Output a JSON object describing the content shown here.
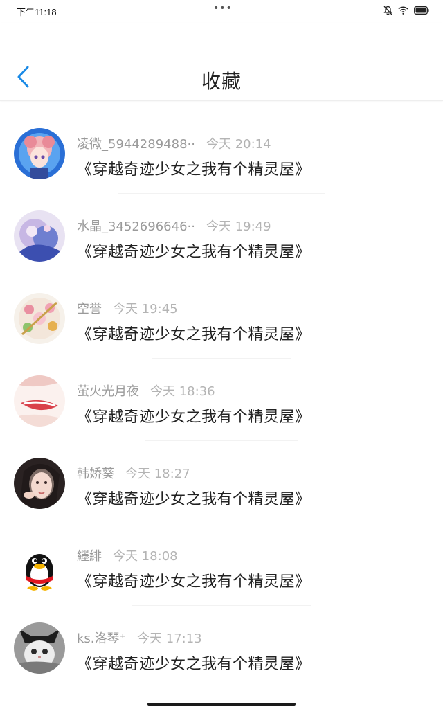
{
  "status": {
    "time": "下午11:18",
    "dots": "•••"
  },
  "header": {
    "title": "收藏"
  },
  "items": [
    {
      "name": "凌微_5944289488··",
      "time": "今天 20:14",
      "title": "《穿越奇迹少女之我有个精灵屋》"
    },
    {
      "name": "水晶_3452696646··",
      "time": "今天 19:49",
      "title": "《穿越奇迹少女之我有个精灵屋》"
    },
    {
      "name": "空誉",
      "time": "今天 19:45",
      "title": "《穿越奇迹少女之我有个精灵屋》"
    },
    {
      "name": "萤火光月夜",
      "time": "今天 18:36",
      "title": "《穿越奇迹少女之我有个精灵屋》"
    },
    {
      "name": "韩娇葵",
      "time": "今天 18:27",
      "title": "《穿越奇迹少女之我有个精灵屋》"
    },
    {
      "name": "纆緋",
      "time": "今天 18:08",
      "title": "《穿越奇迹少女之我有个精灵屋》"
    },
    {
      "name": "ks.洛琴⁺",
      "time": "今天 17:13",
      "title": "《穿越奇迹少女之我有个精灵屋》"
    }
  ],
  "colors": {
    "accent": "#1a8ae6",
    "text": "#222222",
    "meta": "#999999"
  }
}
